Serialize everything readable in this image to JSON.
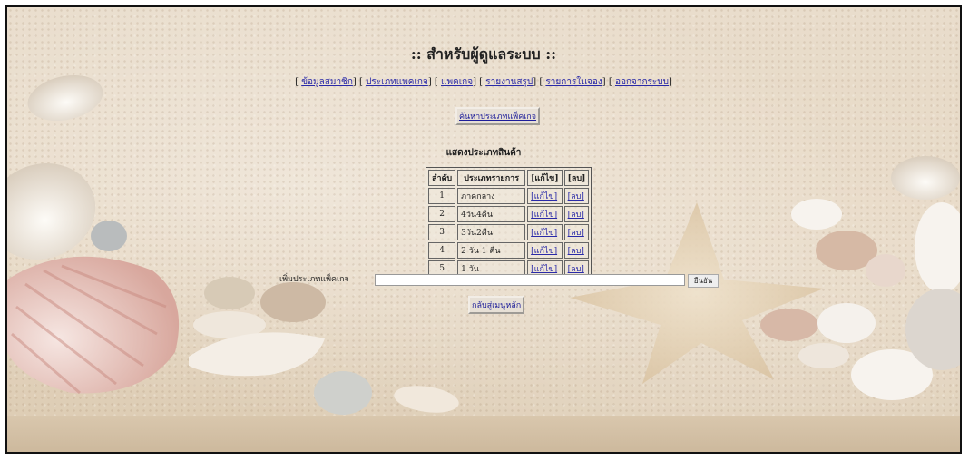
{
  "title": ":: สำหรับผู้ดูแลระบบ ::",
  "nav": [
    {
      "label": "ข้อมูลสมาชิก"
    },
    {
      "label": "ประเภทแพคเกจ"
    },
    {
      "label": "แพคเกจ"
    },
    {
      "label": "รายงานสรุป"
    },
    {
      "label": "รายการในจอง"
    },
    {
      "label": "ออกจากระบบ"
    }
  ],
  "search_button": "ค้นหาประเภทแพ็คเกจ",
  "section_title": "แสดงประเภทสินค้า",
  "table": {
    "headers": [
      "ลำดับ",
      "ประเภทรายการ",
      "[แก้ไข]",
      "[ลบ]"
    ],
    "rows": [
      {
        "no": "1",
        "name": "ภาคกลาง",
        "edit": "[แก้ไข]",
        "del": "[ลบ]"
      },
      {
        "no": "2",
        "name": "4วัน4คืน",
        "edit": "[แก้ไข]",
        "del": "[ลบ]"
      },
      {
        "no": "3",
        "name": "3วัน2คืน",
        "edit": "[แก้ไข]",
        "del": "[ลบ]"
      },
      {
        "no": "4",
        "name": "2 วัน 1 คืน",
        "edit": "[แก้ไข]",
        "del": "[ลบ]"
      },
      {
        "no": "5",
        "name": "1 วัน",
        "edit": "[แก้ไข]",
        "del": "[ลบ]"
      }
    ]
  },
  "add_label": "เพิ่มประเภทแพ็คเกจ",
  "add_value": "",
  "confirm_label": "ยืนยัน",
  "back_button": "กลับสู่เมนูหลัก",
  "colors": {
    "link": "#2a2aa8",
    "sand": "#e6d7c2"
  }
}
